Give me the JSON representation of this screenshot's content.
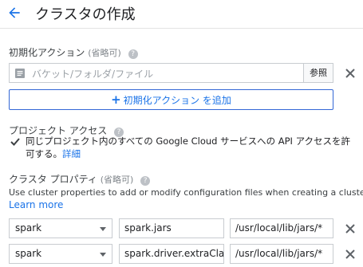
{
  "header": {
    "title": "クラスタの作成"
  },
  "init_actions": {
    "label": "初期化アクション",
    "optional": "(省略可)",
    "placeholder": "バケット/フォルダ/ファイル",
    "browse_label": "参照",
    "add_label": "初期化アクション を追加"
  },
  "project_access": {
    "label": "プロジェクト アクセス",
    "checked": true,
    "text": "同じプロジェクト内のすべての Google Cloud サービスへの API アクセスを許可する。",
    "details_link": "詳細"
  },
  "cluster_properties": {
    "label": "クラスタ プロパティ",
    "optional": "(省略可)",
    "description": "Use cluster properties to add or modify configuration files when creating a cluster.",
    "learn_more": "Learn more",
    "rows": [
      {
        "prefix": "spark",
        "key": "spark.jars",
        "value": "/usr/local/lib/jars/*"
      },
      {
        "prefix": "spark",
        "key": "spark.driver.extraClas",
        "value": "/usr/local/lib/jars/*"
      }
    ]
  },
  "colors": {
    "accent": "#1a73e8",
    "border": "#c8ccd0"
  },
  "icons": [
    "back-arrow-icon",
    "help-icon",
    "file-icon",
    "close-icon",
    "plus-icon",
    "checkmark-icon",
    "dropdown-caret-icon"
  ]
}
